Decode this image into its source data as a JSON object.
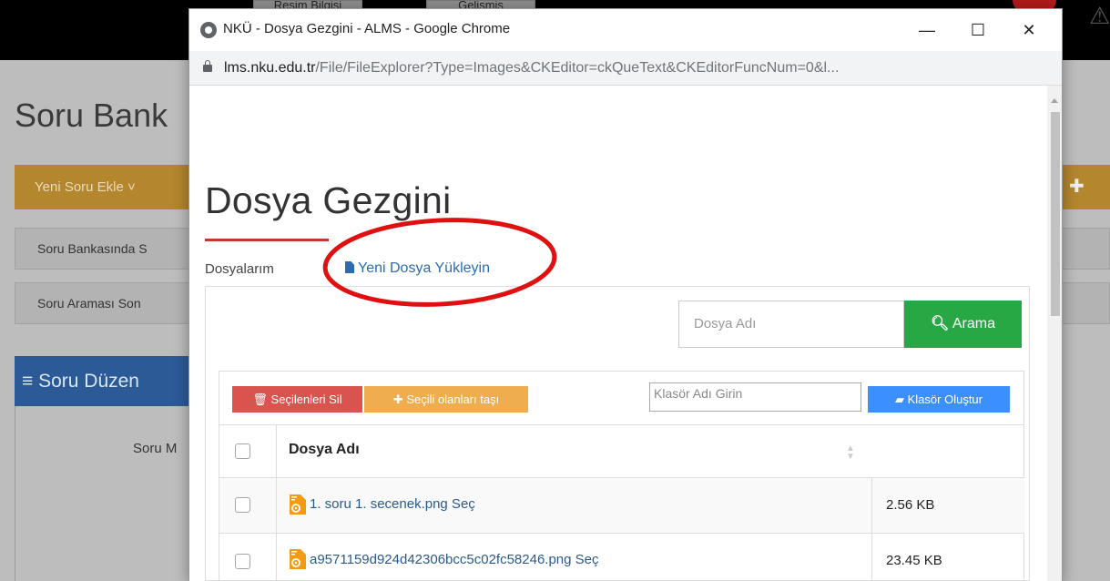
{
  "background_page": {
    "tabs": [
      "Resim Bilgisi",
      "Gelişmiş"
    ],
    "title": "Soru Bank",
    "yeni_button": "Yeni Soru Ekle ˅",
    "rows": [
      "Soru Bankasında S",
      "Soru Araması Son"
    ],
    "blue_header": "≡ Soru Düzen",
    "panel_text": "Soru M"
  },
  "window": {
    "title": "NKÜ - Dosya Gezgini - ALMS - Google Chrome",
    "controls": {
      "minimize": "—",
      "maximize": "☐",
      "close": "✕"
    },
    "url_domain": "lms.nku.edu.tr",
    "url_path": "/File/FileExplorer?Type=Images&CKEditor=ckQueText&CKEditorFuncNum=0&l..."
  },
  "page": {
    "heading": "Dosya Gezgini",
    "tabs": {
      "my_files": "Dosyalarım",
      "upload": "Yeni Dosya Yükleyin"
    },
    "search": {
      "placeholder": "Dosya Adı",
      "button": "Arama"
    },
    "actions": {
      "delete_selected": "Seçilenleri Sil",
      "move_selected": "Seçili olanları taşı",
      "folder_placeholder": "Klasör Adı Girin",
      "create_folder": "Klasör Oluştur"
    },
    "table": {
      "column_name": "Dosya Adı",
      "rows": [
        {
          "name": "1. soru 1. secenek.png Seç",
          "size": "2.56 KB"
        },
        {
          "name": "a9571159d924d42306bcc5c02fc58246.png Seç",
          "size": "23.45 KB"
        }
      ]
    }
  },
  "colors": {
    "accent_red": "#c0392b",
    "search_green": "#28a745",
    "delete_red": "#d9534f",
    "move_orange": "#f0ad4e",
    "folder_blue": "#3b8fff",
    "annotation_red": "#e01010"
  }
}
